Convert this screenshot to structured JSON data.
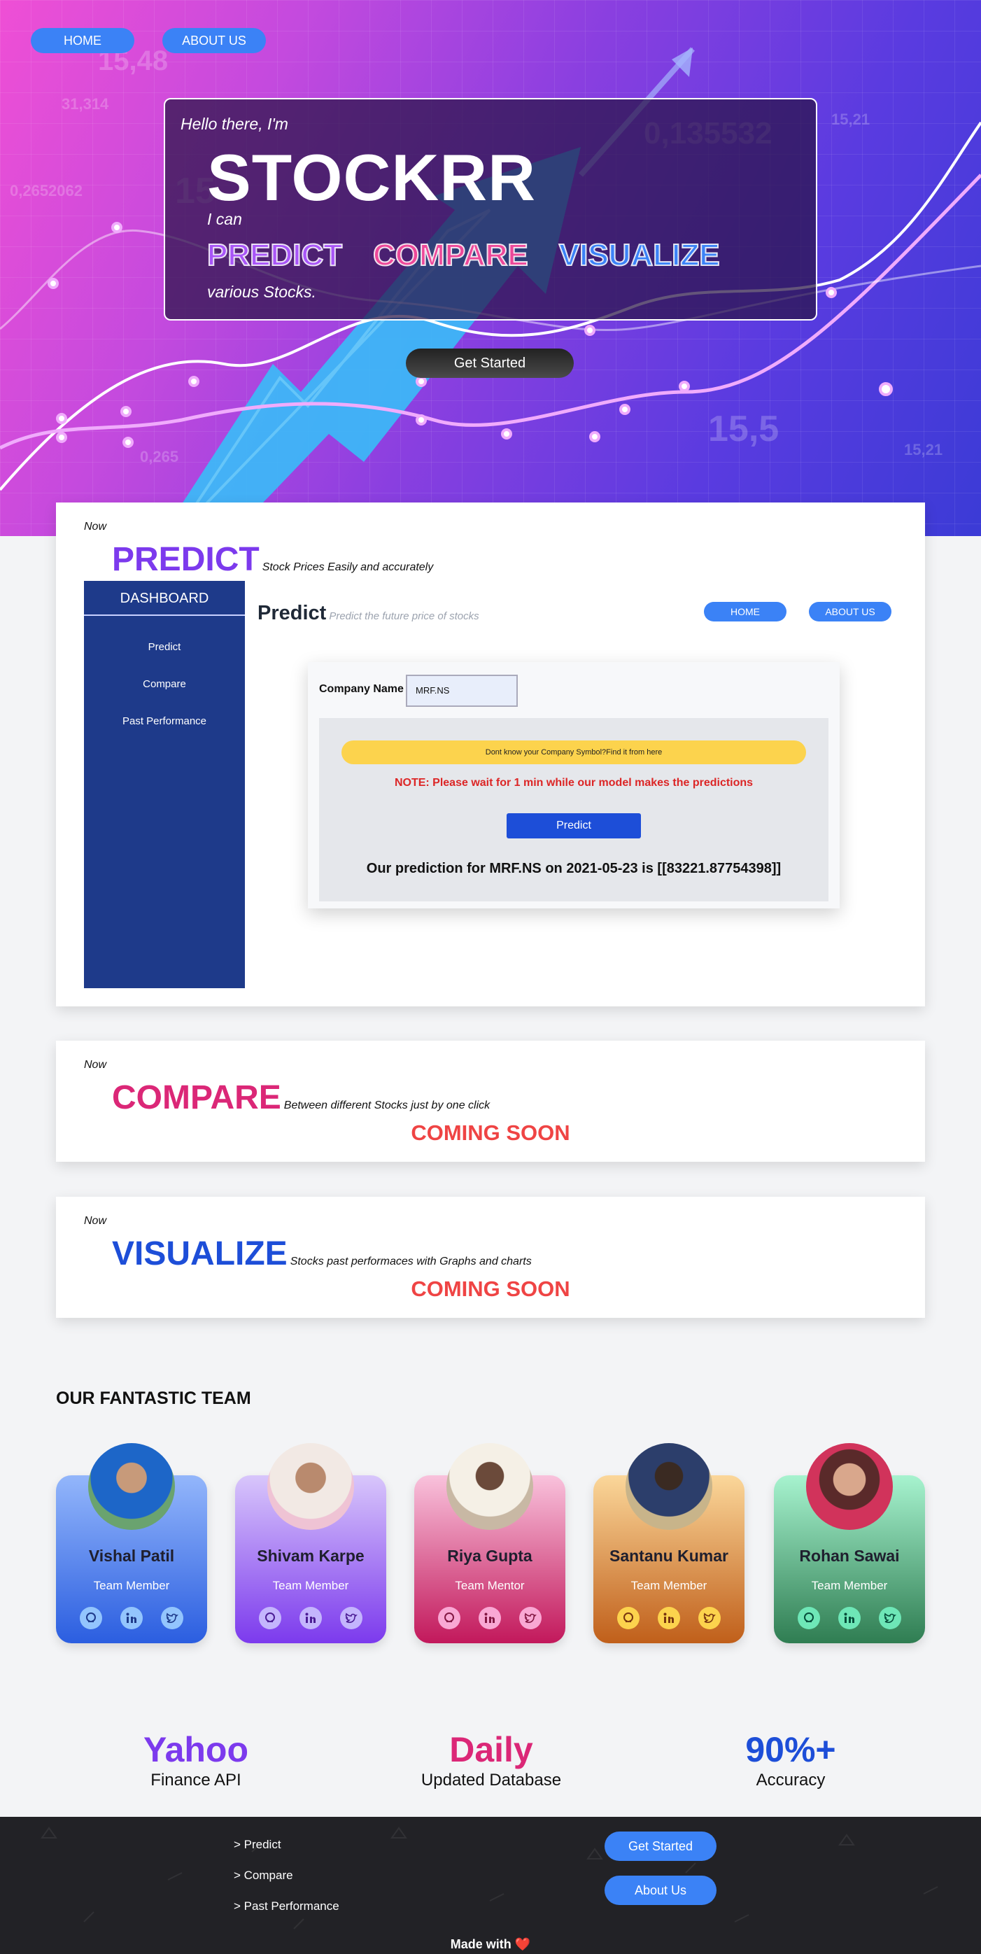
{
  "nav": {
    "home": "HOME",
    "about": "ABOUT US"
  },
  "hero": {
    "hello": "Hello there, I'm",
    "brand": "STOCKRR",
    "ican": "I can",
    "verbs": [
      "PREDICT",
      "COMPARE",
      "VISUALIZE"
    ],
    "various": "various Stocks.",
    "cta": "Get Started",
    "bg_numbers": [
      "15,48",
      "31,314",
      "0,2652062",
      "15",
      "0,135532",
      "15,21",
      "15,5",
      "0,265",
      "15,21",
      "31,314"
    ]
  },
  "predict_card": {
    "now": "Now",
    "title": "PREDICT",
    "subtitle": "Stock Prices Easily and accurately",
    "dashboard": {
      "sidebar_title": "DASHBOARD",
      "sidebar_items": [
        "Predict",
        "Compare",
        "Past Performance"
      ],
      "page_title": "Predict",
      "page_subtitle": "Predict the future price of stocks",
      "home": "HOME",
      "about": "ABOUT US",
      "company_label": "Company Name",
      "company_value": "MRF.NS",
      "find_link": "Dont know your Company Symbol?Find it from here",
      "note": "NOTE: Please wait for 1 min while our model makes the predictions",
      "predict_button": "Predict",
      "result": "Our prediction for MRF.NS on 2021-05-23 is [[83221.87754398]]"
    }
  },
  "compare_card": {
    "now": "Now",
    "title": "COMPARE",
    "subtitle": "Between different Stocks just by one click",
    "status": "COMING SOON"
  },
  "visualize_card": {
    "now": "Now",
    "title": "VISUALIZE",
    "subtitle": "Stocks past performaces with Graphs and charts",
    "status": "COMING SOON"
  },
  "team": {
    "title": "OUR FANTASTIC TEAM",
    "members": [
      {
        "name": "Vishal Patil",
        "role": "Team Member"
      },
      {
        "name": "Shivam Karpe",
        "role": "Team Member"
      },
      {
        "name": "Riya Gupta",
        "role": "Team Mentor"
      },
      {
        "name": "Santanu Kumar",
        "role": "Team Member"
      },
      {
        "name": "Rohan Sawai",
        "role": "Team Member"
      }
    ],
    "social_icons": [
      "github-icon",
      "linkedin-icon",
      "twitter-icon"
    ]
  },
  "stats": [
    {
      "big": "Yahoo",
      "small": "Finance API",
      "color": "#7c3aed"
    },
    {
      "big": "Daily",
      "small": "Updated Database",
      "color": "#db2777"
    },
    {
      "big": "90%+",
      "small": "Accuracy",
      "color": "#1d4ed8"
    }
  ],
  "footer": {
    "links": [
      "> Predict",
      "> Compare",
      "> Past Performance"
    ],
    "get_started": "Get Started",
    "about": "About Us",
    "made_with": "Made with",
    "heart": "❤️"
  },
  "colors": {
    "accent_blue": "#3b82f6",
    "predict_purple": "#7c3aed",
    "compare_pink": "#db2777",
    "visualize_blue": "#1d4ed8",
    "coming_soon_red": "#ef4444"
  }
}
